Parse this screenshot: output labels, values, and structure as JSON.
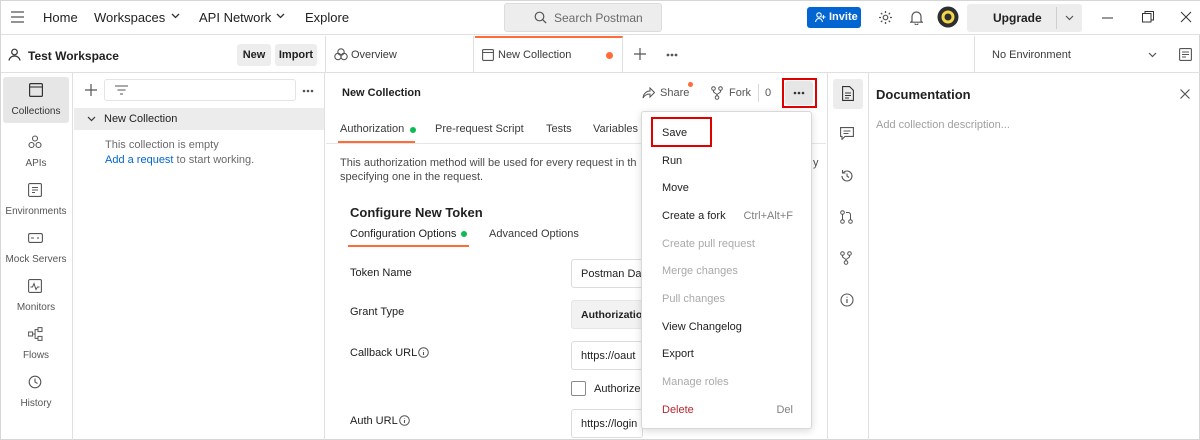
{
  "topbar": {
    "home": "Home",
    "workspaces": "Workspaces",
    "api_network": "API Network",
    "explore": "Explore",
    "search_placeholder": "Search Postman",
    "invite": "Invite",
    "upgrade": "Upgrade"
  },
  "workspace": {
    "name": "Test Workspace",
    "new_label": "New",
    "import_label": "Import"
  },
  "tabs": [
    {
      "label": "Overview"
    },
    {
      "label": "New Collection"
    }
  ],
  "environment": {
    "selected": "No Environment"
  },
  "rail": [
    {
      "label": "Collections"
    },
    {
      "label": "APIs"
    },
    {
      "label": "Environments"
    },
    {
      "label": "Mock Servers"
    },
    {
      "label": "Monitors"
    },
    {
      "label": "Flows"
    },
    {
      "label": "History"
    }
  ],
  "sidebar": {
    "collection_name": "New Collection",
    "empty_text": "This collection is empty",
    "add_request_link": "Add a request",
    "add_request_suffix": " to start working."
  },
  "main": {
    "title": "New Collection",
    "share": "Share",
    "fork": "Fork",
    "fork_count": "0",
    "subtabs": [
      "Authorization",
      "Pre-request Script",
      "Tests",
      "Variables"
    ],
    "auth_description_1": "This authorization method will be used for every request in th",
    "auth_description_1_tail": "y",
    "auth_description_2": "specifying one in the request.",
    "configure_title": "Configure New Token",
    "config_tabs": [
      "Configuration Options",
      "Advanced Options"
    ],
    "fields": {
      "token_name_label": "Token Name",
      "token_name_value": "Postman Da",
      "grant_type_label": "Grant Type",
      "grant_type_value": "Authorization",
      "callback_url_label": "Callback URL",
      "callback_url_value": "https://oaut",
      "authorize_label": "Authorize",
      "auth_url_label": "Auth URL",
      "auth_url_value": "https://login"
    }
  },
  "menu": {
    "items": [
      {
        "label": "Save",
        "disabled": false
      },
      {
        "label": "Run",
        "disabled": false
      },
      {
        "label": "Move",
        "disabled": false
      },
      {
        "label": "Create a fork",
        "shortcut": "Ctrl+Alt+F",
        "disabled": false
      },
      {
        "label": "Create pull request",
        "disabled": true
      },
      {
        "label": "Merge changes",
        "disabled": true
      },
      {
        "label": "Pull changes",
        "disabled": true
      },
      {
        "label": "View Changelog",
        "disabled": false
      },
      {
        "label": "Export",
        "disabled": false
      },
      {
        "label": "Manage roles",
        "disabled": true
      },
      {
        "label": "Delete",
        "shortcut": "Del",
        "disabled": false
      }
    ]
  },
  "documentation": {
    "title": "Documentation",
    "placeholder": "Add collection description..."
  },
  "colors": {
    "accent_orange": "#ff6c37",
    "invite_blue": "#0265d2",
    "link_blue": "#0265d2",
    "highlight_red": "#e10000",
    "success_green": "#0cbb52",
    "danger_red": "#b5282f"
  }
}
